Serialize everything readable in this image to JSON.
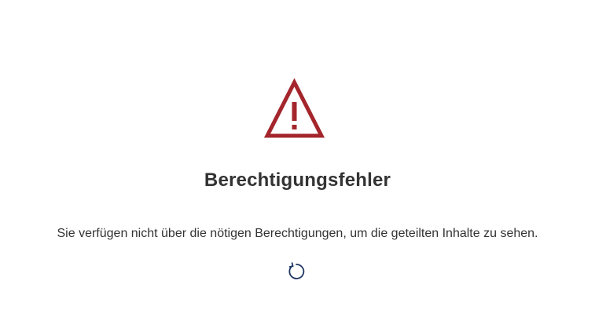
{
  "error": {
    "icon": "warning-triangle-icon",
    "icon_color": "#a4262c",
    "title": "Berechtigungsfehler",
    "message": "Sie verfügen nicht über die nötigen Berechtigungen, um die geteilten Inhalte zu sehen.",
    "refresh_icon": "refresh-icon",
    "refresh_color": "#1f3864"
  }
}
